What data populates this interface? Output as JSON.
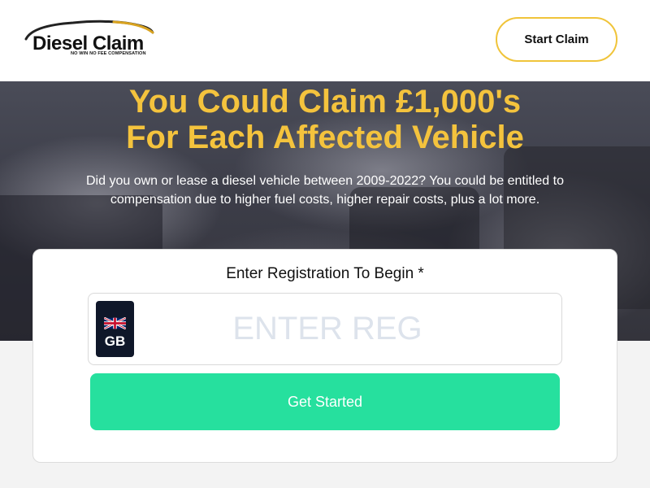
{
  "header": {
    "logo_name": "Diesel Claim",
    "logo_tagline": "NO WIN NO FEE COMPENSATION",
    "start_claim_label": "Start Claim"
  },
  "hero": {
    "title_line1": "You Could Claim £1,000's",
    "title_line2": "For Each Affected Vehicle",
    "subtitle_line1": "Did you own or lease a diesel vehicle between 2009-2022? You could be entitled to",
    "subtitle_line2": "compensation due to higher fuel costs, higher repair costs, plus a lot more."
  },
  "form": {
    "label": "Enter Registration To Begin *",
    "country_code": "GB",
    "reg_placeholder": "ENTER REG",
    "reg_value": "",
    "submit_label": "Get Started"
  },
  "colors": {
    "accent_yellow": "#f4c33d",
    "cta_green": "#26e09e",
    "plate_navy": "#0f1729"
  },
  "icons": {
    "logo": "car-outline-logo-icon",
    "flag": "union-jack-flag-icon"
  }
}
